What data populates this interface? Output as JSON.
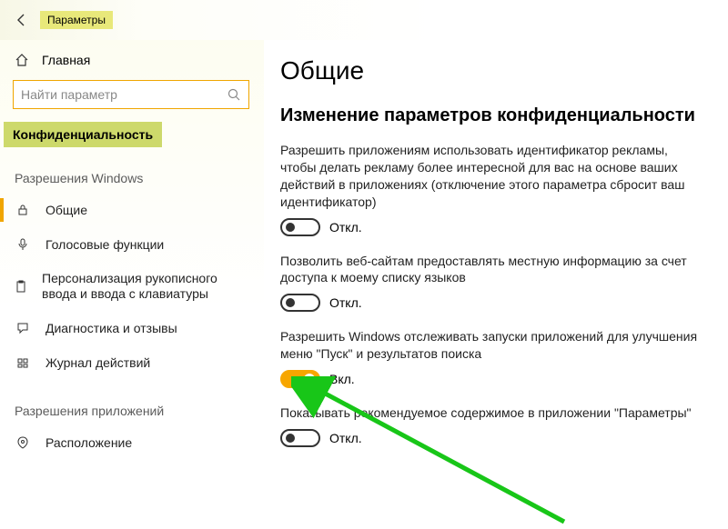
{
  "header": {
    "title": "Параметры"
  },
  "sidebar": {
    "home": "Главная",
    "search_placeholder": "Найти параметр",
    "category": "Конфиденциальность",
    "group1": "Разрешения Windows",
    "group2": "Разрешения приложений",
    "items": [
      {
        "label": "Общие"
      },
      {
        "label": "Голосовые функции"
      },
      {
        "label": "Персонализация рукописного ввода и ввода с клавиатуры"
      },
      {
        "label": "Диагностика и отзывы"
      },
      {
        "label": "Журнал действий"
      }
    ],
    "items2": [
      {
        "label": "Расположение"
      }
    ]
  },
  "content": {
    "h1": "Общие",
    "h2": "Изменение параметров конфиденциальности",
    "settings": [
      {
        "text": "Разрешить приложениям использовать идентификатор рекламы, чтобы делать рекламу более интересной для вас на основе ваших действий в приложениях (отключение этого параметра сбросит ваш идентификатор)",
        "state": "Откл.",
        "on": false
      },
      {
        "text": "Позволить веб-сайтам предоставлять местную информацию за счет доступа к моему списку языков",
        "state": "Откл.",
        "on": false
      },
      {
        "text": "Разрешить Windows отслеживать запуски приложений для улучшения меню \"Пуск\" и результатов поиска",
        "state": "Вкл.",
        "on": true
      },
      {
        "text": "Показывать рекомендуемое содержимое в приложении \"Параметры\"",
        "state": "Откл.",
        "on": false
      }
    ]
  }
}
